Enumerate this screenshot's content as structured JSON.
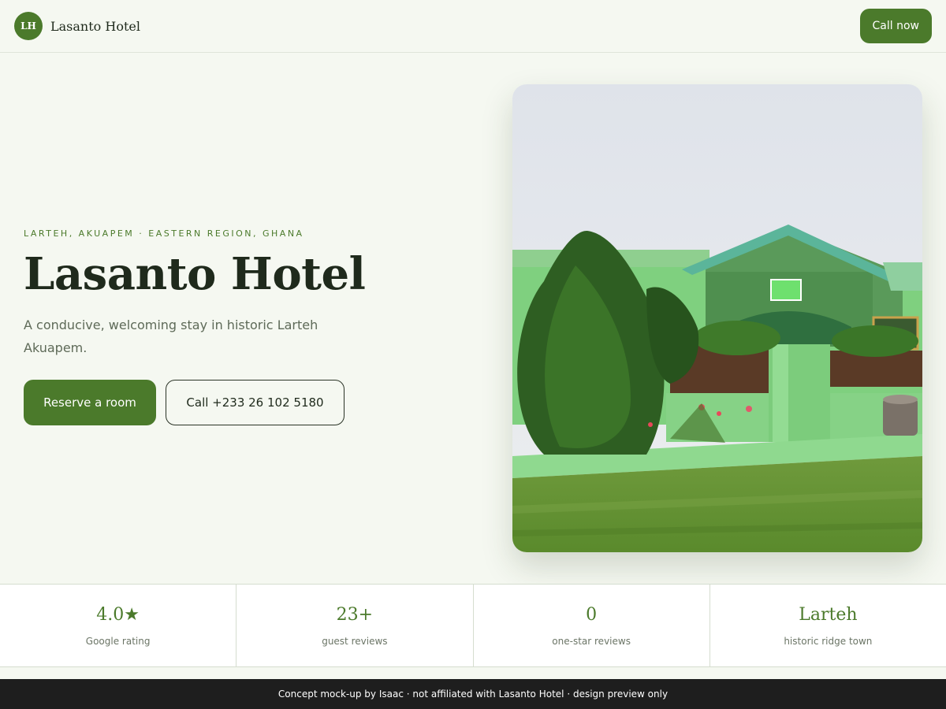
{
  "header": {
    "badge": "LH",
    "brand_name": "Lasanto Hotel",
    "call_label": "Call now"
  },
  "hero": {
    "eyebrow": "LARTEH, AKUAPEM · EASTERN REGION, GHANA",
    "title": "Lasanto Hotel",
    "subtitle": "A conducive, welcoming stay in historic Larteh Akuapem.",
    "primary_label": "Reserve a room",
    "secondary_label": "Call +233 26 102 5180"
  },
  "stats": [
    {
      "value": "4.0★",
      "label": "Google rating"
    },
    {
      "value": "23+",
      "label": "guest reviews"
    },
    {
      "value": "0",
      "label": "one-star reviews"
    },
    {
      "value": "Larteh",
      "label": "historic ridge town"
    }
  ],
  "footer": {
    "text": "Concept mock-up by Isaac · not affiliated with Lasanto Hotel · design preview only"
  },
  "colors": {
    "accent": "#4b7a2b",
    "background": "#f5f8f1",
    "footer_bg": "#1e1e1e"
  }
}
